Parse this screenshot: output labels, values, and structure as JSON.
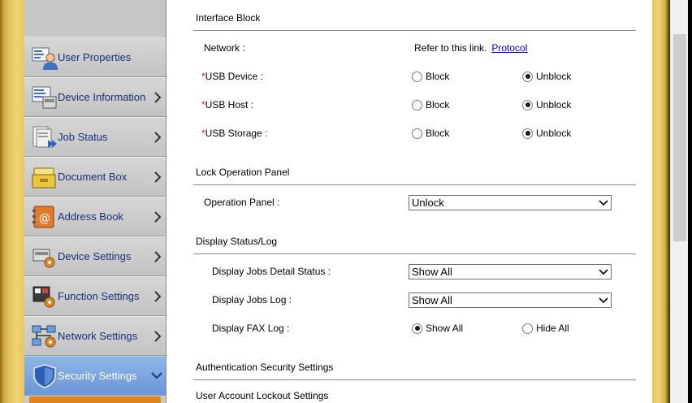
{
  "sidebar": {
    "items": [
      {
        "label": "User Properties",
        "icon": "user-properties-icon",
        "chevron": false
      },
      {
        "label": "Device Information",
        "icon": "device-information-icon",
        "chevron": true
      },
      {
        "label": "Job Status",
        "icon": "job-status-icon",
        "chevron": true
      },
      {
        "label": "Document Box",
        "icon": "document-box-icon",
        "chevron": true
      },
      {
        "label": "Address Book",
        "icon": "address-book-icon",
        "chevron": true
      },
      {
        "label": "Device Settings",
        "icon": "device-settings-icon",
        "chevron": true
      },
      {
        "label": "Function Settings",
        "icon": "function-settings-icon",
        "chevron": true
      },
      {
        "label": "Network Settings",
        "icon": "network-settings-icon",
        "chevron": true
      },
      {
        "label": "Security Settings",
        "icon": "security-settings-icon",
        "chevron": true,
        "active": true,
        "expanded": true
      }
    ]
  },
  "main": {
    "interface_block": {
      "title": "Interface Block",
      "network_label": "Network :",
      "network_text": "Refer to this link.",
      "network_link": "Protocol",
      "rows": [
        {
          "required": "*",
          "label": "USB Device :",
          "block": "Block",
          "unblock": "Unblock",
          "selected": "Unblock"
        },
        {
          "required": "*",
          "label": "USB Host :",
          "block": "Block",
          "unblock": "Unblock",
          "selected": "Unblock"
        },
        {
          "required": "*",
          "label": "USB Storage :",
          "block": "Block",
          "unblock": "Unblock",
          "selected": "Unblock"
        }
      ]
    },
    "lock_operation_panel": {
      "title": "Lock Operation Panel",
      "operation_panel_label": "Operation Panel :",
      "operation_panel_value": "Unlock"
    },
    "display_status_log": {
      "title": "Display Status/Log",
      "jobs_detail_label": "Display Jobs Detail Status :",
      "jobs_detail_value": "Show All",
      "jobs_log_label": "Display Jobs Log :",
      "jobs_log_value": "Show All",
      "fax_log_label": "Display FAX Log :",
      "fax_show_all": "Show All",
      "fax_hide_all": "Hide All",
      "fax_selected": "Show All"
    },
    "auth_security_title": "Authentication Security Settings",
    "lockout_title": "User Account Lockout Settings"
  },
  "colors": {
    "nav_text": "#1a2f7a",
    "nav_active_bg": "#7aa3de",
    "link": "#0000cc",
    "required": "#d62020",
    "submenu_accent": "#e0821e"
  }
}
